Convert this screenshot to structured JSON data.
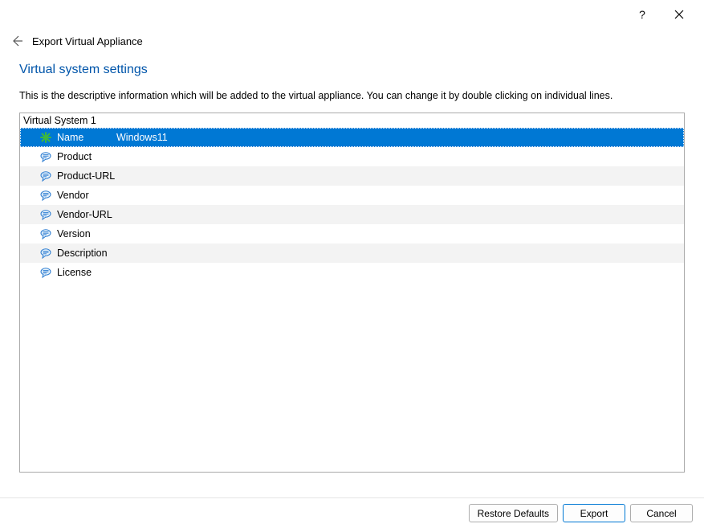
{
  "titlebar": {
    "help": "?",
    "close": "✕"
  },
  "header": {
    "title": "Export Virtual Appliance"
  },
  "section": {
    "title": "Virtual system settings",
    "description": "This is the descriptive information which will be added to the virtual appliance. You can change it by double clicking on individual lines."
  },
  "table": {
    "group_label": "Virtual System 1",
    "rows": [
      {
        "label": "Name",
        "value": "Windows11",
        "icon": "name",
        "selected": true
      },
      {
        "label": "Product",
        "value": "",
        "icon": "text",
        "selected": false
      },
      {
        "label": "Product-URL",
        "value": "",
        "icon": "text",
        "selected": false
      },
      {
        "label": "Vendor",
        "value": "",
        "icon": "text",
        "selected": false
      },
      {
        "label": "Vendor-URL",
        "value": "",
        "icon": "text",
        "selected": false
      },
      {
        "label": "Version",
        "value": "",
        "icon": "text",
        "selected": false
      },
      {
        "label": "Description",
        "value": "",
        "icon": "text",
        "selected": false
      },
      {
        "label": "License",
        "value": "",
        "icon": "text",
        "selected": false
      }
    ]
  },
  "buttons": {
    "restore": "Restore Defaults",
    "export": "Export",
    "cancel": "Cancel"
  }
}
